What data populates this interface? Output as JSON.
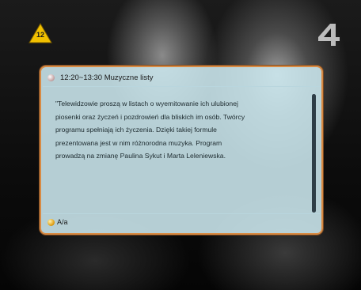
{
  "rating_badge": {
    "age": "12",
    "color": "#f1c000"
  },
  "channel_logo": {
    "text": "4",
    "color": "#d7d7d7"
  },
  "epg": {
    "title": "12:20~13:30  Muzyczne listy",
    "description_lines": [
      "\"Telewidzowie proszą w listach o wyemitowanie ich ulubionej",
      "piosenki oraz życzeń i pozdrowień dla bliskich im osób. Twórcy",
      " programu spełniają ich życzenia. Dzięki takiej formule",
      "prezentowana jest w nim różnorodna muzyka. Program",
      "prowadzą na zmianę Paulina Sykut i Marta Leleniewska."
    ],
    "footer_label": "A/a",
    "border_color": "#d88a43",
    "panel_color": "#cde9f0"
  }
}
